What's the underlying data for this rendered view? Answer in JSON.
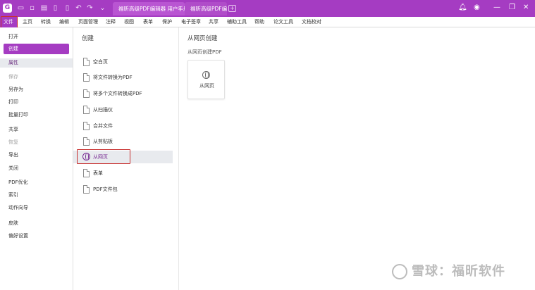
{
  "titlebar": {
    "doc_tabs": [
      {
        "label": "福昕高级PDF编辑器 用户手册"
      },
      {
        "label": "福昕高级PDF编辑器..."
      }
    ],
    "new_tab_symbol": "+",
    "close_symbol": "×",
    "window_controls": {
      "restore": "❐",
      "close": "✕"
    }
  },
  "menubar": {
    "items": [
      "文件",
      "主页",
      "转换",
      "编辑",
      "页面管理",
      "注释",
      "视图",
      "表单",
      "保护",
      "电子签章",
      "共享",
      "辅助工具",
      "帮助",
      "论文工具",
      "文档校对"
    ],
    "active_index": 0
  },
  "left_nav": {
    "items": [
      {
        "label": "打开",
        "state": "normal"
      },
      {
        "label": "创建",
        "state": "selected"
      },
      {
        "label": "属性",
        "state": "hover"
      },
      {
        "label": "保存",
        "state": "disabled"
      },
      {
        "label": "另存为",
        "state": "normal"
      },
      {
        "label": "打印",
        "state": "normal"
      },
      {
        "label": "批量打印",
        "state": "normal"
      },
      {
        "label": "共享",
        "state": "normal"
      },
      {
        "label": "恢复",
        "state": "disabled"
      },
      {
        "label": "导出",
        "state": "normal"
      },
      {
        "label": "关闭",
        "state": "normal"
      },
      {
        "label": "PDF优化",
        "state": "normal"
      },
      {
        "label": "索引",
        "state": "normal"
      },
      {
        "label": "动作向导",
        "state": "normal"
      },
      {
        "label": "皮肤",
        "state": "normal"
      },
      {
        "label": "偏好设置",
        "state": "normal"
      }
    ]
  },
  "create_panel": {
    "heading": "创建",
    "items": [
      {
        "label": "空白页",
        "icon": "blank-page-icon"
      },
      {
        "label": "将文件转换为PDF",
        "icon": "convert-file-icon"
      },
      {
        "label": "将多个文件转换成PDF",
        "icon": "convert-multiple-icon"
      },
      {
        "label": "从扫描仪",
        "icon": "scanner-icon"
      },
      {
        "label": "合并文件",
        "icon": "merge-files-icon"
      },
      {
        "label": "从剪贴板",
        "icon": "clipboard-icon"
      },
      {
        "label": "从网页",
        "icon": "web-page-icon"
      },
      {
        "label": "表单",
        "icon": "form-icon"
      },
      {
        "label": "PDF文件包",
        "icon": "pdf-portfolio-icon"
      }
    ],
    "selected_index": 6
  },
  "web_panel": {
    "heading": "从网页创建",
    "subheading": "从网页创建PDF",
    "card_label": "从网页"
  },
  "watermark": {
    "text": "雪球：福昕软件"
  },
  "colors": {
    "accent": "#a53cc2",
    "highlight_box": "#c8302f",
    "hover_bg": "#e8eaee"
  }
}
